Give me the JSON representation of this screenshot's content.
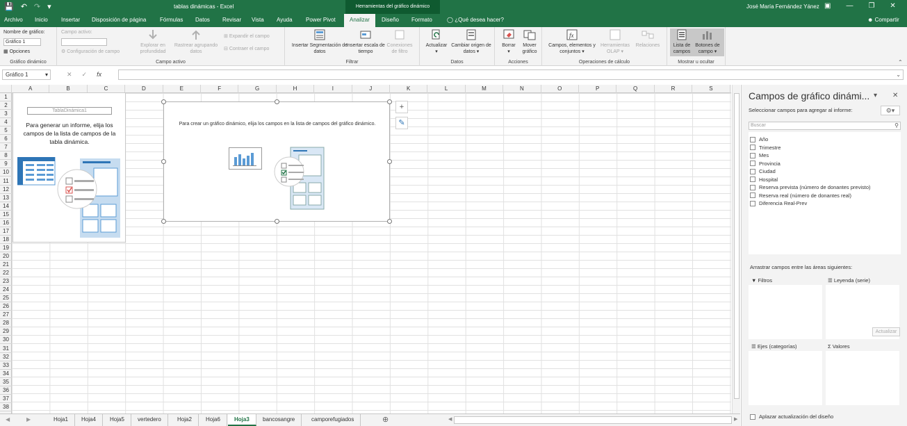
{
  "titlebar": {
    "title": "tablas dinámicas  -  Excel",
    "context": "Herramientas del gráfico dinámico",
    "user": "José María Fernández Yánez"
  },
  "tabs": [
    "Archivo",
    "Inicio",
    "Insertar",
    "Disposición de página",
    "Fórmulas",
    "Datos",
    "Revisar",
    "Vista",
    "Ayuda",
    "Power Pivot",
    "Analizar",
    "Diseño",
    "Formato"
  ],
  "tell_me": "¿Qué desea hacer?",
  "share": "Compartir",
  "ribbon": {
    "chart_name_label": "Nombre de gráfico:",
    "chart_name_value": "Gráfico 1",
    "options": "Opciones",
    "group1": "Gráfico dinámico",
    "active_field_label": "Campo activo:",
    "field_config": "Configuración de campo",
    "drill_down": "Explorar en profundidad",
    "drill_up": "Rastrear agrupando datos",
    "expand_field": "Expandir el campo",
    "collapse_field": "Contraer el campo",
    "group2": "Campo activo",
    "insert_slicer": "Insertar Segmentación de datos",
    "insert_timeline": "Insertar escala de tiempo",
    "filter_connections": "Conexiones de filtro",
    "group3": "Filtrar",
    "refresh": "Actualizar",
    "change_source": "Cambiar origen de datos",
    "group4": "Datos",
    "clear": "Borrar",
    "move_chart": "Mover gráfico",
    "group5": "Acciones",
    "fields_items": "Campos, elementos y conjuntos",
    "olap_tools": "Herramientas OLAP",
    "relationships": "Relaciones",
    "group6": "Operaciones de cálculo",
    "field_list": "Lista de campos",
    "field_buttons": "Botones de campo",
    "group7": "Mostrar u ocultar"
  },
  "namebox": "Gráfico 1",
  "columns": [
    "A",
    "B",
    "C",
    "D",
    "E",
    "F",
    "G",
    "H",
    "I",
    "J",
    "K",
    "L",
    "M",
    "N",
    "O",
    "P",
    "Q",
    "R",
    "S"
  ],
  "rows": [
    "1",
    "2",
    "3",
    "4",
    "5",
    "6",
    "7",
    "8",
    "9",
    "10",
    "11",
    "12",
    "13",
    "14",
    "15",
    "16",
    "17",
    "18",
    "19",
    "20",
    "21",
    "22",
    "23",
    "24",
    "25",
    "26",
    "27",
    "28",
    "29",
    "30",
    "31",
    "32",
    "33",
    "34",
    "35",
    "36",
    "37",
    "38"
  ],
  "pivot": {
    "name": "TablaDinámica1",
    "message": "Para generar un informe, elija los campos de la lista de campos de la tabla dinámica."
  },
  "chart": {
    "message": "Para crear un gráfico dinámico, elija los campos en la lista de campos del gráfico dinámico."
  },
  "sheets": [
    "Hoja1",
    "Hoja4",
    "Hoja5",
    "vertedero",
    "Hoja2",
    "Hoja6",
    "Hoja3",
    "bancosangre",
    "camporefugiados"
  ],
  "active_sheet": "Hoja3",
  "pane": {
    "title": "Campos de gráfico dinámi...",
    "subtitle": "Seleccionar campos para agregar al informe:",
    "search_placeholder": "Buscar",
    "fields": [
      "Año",
      "Trimestre",
      "Mes",
      "Provincia",
      "Ciudad",
      "Hospital",
      "Reserva prevista (número de donantes previsto)",
      "Reserva real (número de donantes real)",
      "Diferencia Real-Prev"
    ],
    "drag_label": "Arrastrar campos entre las áreas siguientes:",
    "filters": "Filtros",
    "legend": "Leyenda (serie)",
    "axes": "Ejes (categorías)",
    "values": "Valores",
    "defer": "Aplazar actualización del diseño",
    "update": "Actualizar"
  }
}
